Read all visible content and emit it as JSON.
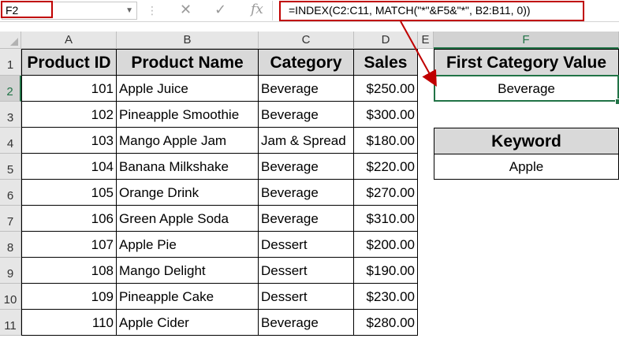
{
  "formula_bar": {
    "name_box": "F2",
    "formula": "=INDEX(C2:C11, MATCH(\"*\"&F5&\"*\", B2:B11, 0))",
    "cancel_icon": "x-icon",
    "enter_icon": "check-icon",
    "function_icon": "fx-icon",
    "fx_label": "fx"
  },
  "columns": [
    "A",
    "B",
    "C",
    "D",
    "E",
    "F"
  ],
  "rows": [
    "1",
    "2",
    "3",
    "4",
    "5",
    "6",
    "7",
    "8",
    "9",
    "10",
    "11"
  ],
  "table": {
    "headers": [
      "Product ID",
      "Product Name",
      "Category",
      "Sales"
    ],
    "rows": [
      [
        "101",
        "Apple Juice",
        "Beverage",
        "$250.00"
      ],
      [
        "102",
        "Pineapple Smoothie",
        "Beverage",
        "$300.00"
      ],
      [
        "103",
        "Mango Apple Jam",
        "Jam & Spread",
        "$180.00"
      ],
      [
        "104",
        "Banana Milkshake",
        "Beverage",
        "$220.00"
      ],
      [
        "105",
        "Orange Drink",
        "Beverage",
        "$270.00"
      ],
      [
        "106",
        "Green Apple Soda",
        "Beverage",
        "$310.00"
      ],
      [
        "107",
        "Apple Pie",
        "Dessert",
        "$200.00"
      ],
      [
        "108",
        "Mango Delight",
        "Dessert",
        "$190.00"
      ],
      [
        "109",
        "Pineapple Cake",
        "Dessert",
        "$230.00"
      ],
      [
        "110",
        "Apple Cider",
        "Beverage",
        "$280.00"
      ]
    ]
  },
  "result": {
    "header": "First Category Value",
    "value": "Beverage"
  },
  "keyword": {
    "header": "Keyword",
    "value": "Apple"
  },
  "colors": {
    "highlight_red": "#c00000",
    "selection_green": "#217346",
    "header_fill": "#d9d9d9"
  }
}
